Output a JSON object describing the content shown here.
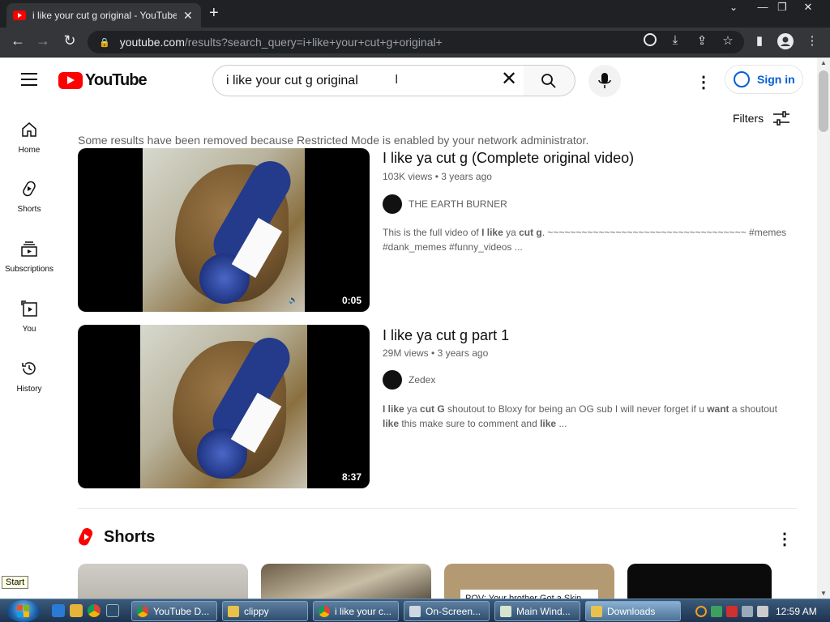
{
  "browser": {
    "tab_title": "i like your cut g original - YouTube",
    "new_tab": "+",
    "url_host": "youtube.com",
    "url_rest": "/results?search_query=i+like+your+cut+g+original+",
    "window_controls": [
      "—",
      "❐",
      "✕"
    ]
  },
  "youtube": {
    "logo_text": "YouTube",
    "search_value": "i like your cut g original",
    "sign_in": "Sign in",
    "filters": "Filters",
    "sidebar": [
      {
        "label": "Home",
        "icon": "home-icon"
      },
      {
        "label": "Shorts",
        "icon": "shorts-icon"
      },
      {
        "label": "Subscriptions",
        "icon": "subscriptions-icon"
      },
      {
        "label": "You",
        "icon": "you-icon"
      },
      {
        "label": "History",
        "icon": "history-icon"
      }
    ],
    "restricted_notice": "Some results have been removed because Restricted Mode is enabled by your network administrator.",
    "videos": [
      {
        "title": "I like ya cut g (Complete original video)",
        "views": "103K views",
        "age": "3 years ago",
        "channel": "THE EARTH BURNER",
        "duration": "0:05",
        "desc_pre": "This is the full video of ",
        "desc_b1": "I like",
        "desc_mid": " ya ",
        "desc_b2": "cut g",
        "desc_post": ". ~~~~~~~~~~~~~~~~~~~~~~~~~~~~~~~~~~~ #memes #dank_memes #funny_videos ..."
      },
      {
        "title": "I like ya cut g part 1",
        "views": "29M views",
        "age": "3 years ago",
        "channel": "Zedex",
        "duration": "8:37",
        "desc_b1": "I like",
        "desc_mid": " ya ",
        "desc_b2": "cut G",
        "desc_post": " shoutout to Bloxy for being an OG sub I will never forget if u ",
        "desc_b3": "want",
        "desc_post2": " a shoutout ",
        "desc_b4": "like",
        "desc_post3": " this make sure to comment and ",
        "desc_b5": "like",
        "desc_post4": " ..."
      }
    ],
    "shorts_heading": "Shorts",
    "short_caption": "POV: Your brother Got a Skin"
  },
  "start_tooltip": "Start",
  "taskbar": {
    "buttons": [
      {
        "label": "YouTube D...",
        "active": false
      },
      {
        "label": "clippy",
        "active": false
      },
      {
        "label": "i like your c...",
        "active": false
      },
      {
        "label": "On-Screen...",
        "active": false
      },
      {
        "label": "Main Wind...",
        "active": false
      },
      {
        "label": "Downloads",
        "active": true
      }
    ],
    "clock": "12:59 AM"
  },
  "colors": {
    "brand": "#ff0000",
    "link": "#065fd4"
  }
}
